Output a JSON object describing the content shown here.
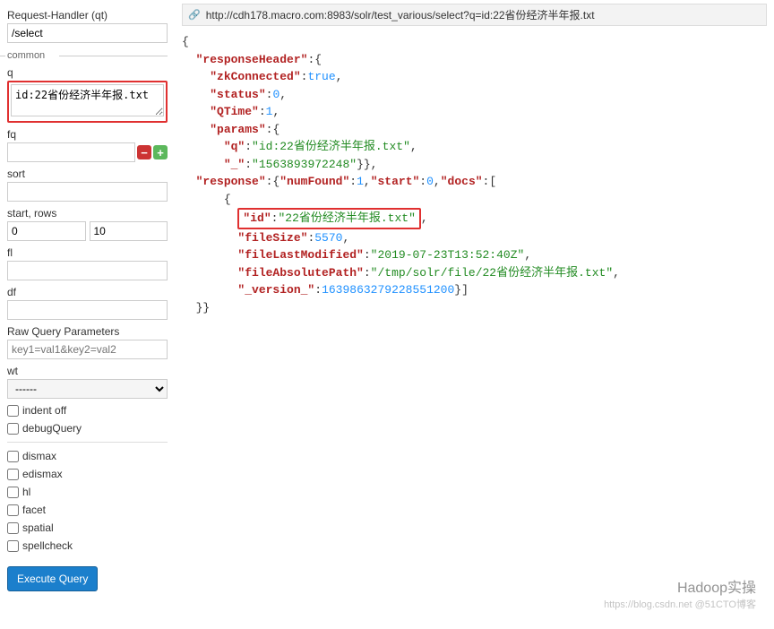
{
  "sidebar": {
    "qt_label": "Request-Handler (qt)",
    "qt_value": "/select",
    "common_legend": "common",
    "q_label": "q",
    "q_value": "id:22省份经济半年报.txt",
    "fq_label": "fq",
    "fq_value": "",
    "sort_label": "sort",
    "sort_value": "",
    "start_rows_label": "start, rows",
    "start_value": "0",
    "rows_value": "10",
    "fl_label": "fl",
    "fl_value": "",
    "df_label": "df",
    "df_value": "",
    "raw_label": "Raw Query Parameters",
    "raw_placeholder": "key1=val1&key2=val2",
    "wt_label": "wt",
    "wt_value": "------",
    "indent_label": "indent off",
    "debug_label": "debugQuery",
    "dismax_label": "dismax",
    "edismax_label": "edismax",
    "hl_label": "hl",
    "facet_label": "facet",
    "spatial_label": "spatial",
    "spellcheck_label": "spellcheck",
    "execute_label": "Execute Query"
  },
  "main": {
    "url": "http://cdh178.macro.com:8983/solr/test_various/select?q=id:22省份经济半年报.txt",
    "response": {
      "responseHeader": {
        "zkConnected": true,
        "status": 0,
        "QTime": 1,
        "params": {
          "q": "id:22省份经济半年报.txt",
          "_": "1563893972248"
        }
      },
      "response": {
        "numFound": 1,
        "start": 0,
        "docs": [
          {
            "id": "22省份经济半年报.txt",
            "fileSize": 5570,
            "fileLastModified": "2019-07-23T13:52:40Z",
            "fileAbsolutePath": "/tmp/solr/file/22省份经济半年报.txt",
            "_version_": 1639863279228551168
          }
        ]
      }
    }
  },
  "watermark": {
    "line1": "Hadoop实操",
    "line2": "https://blog.csdn.net @51CTO博客"
  }
}
